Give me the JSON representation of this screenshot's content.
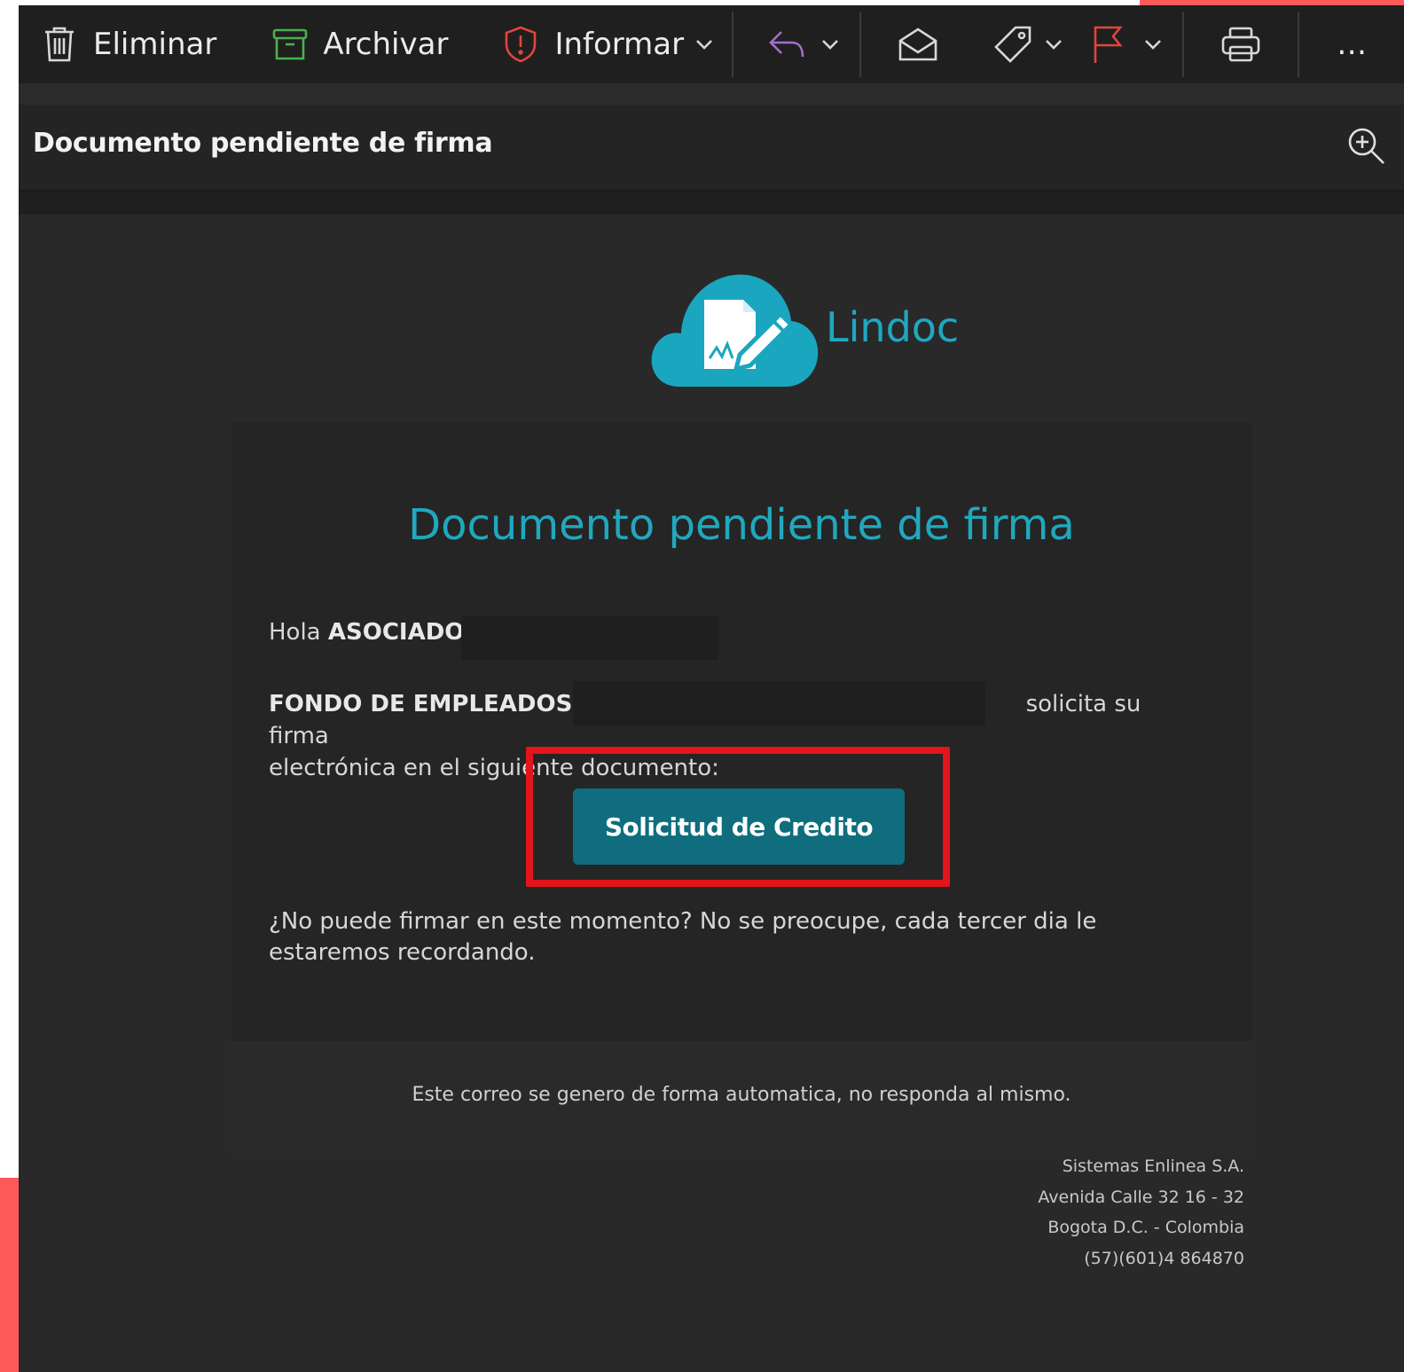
{
  "toolbar": {
    "delete_label": "Eliminar",
    "archive_label": "Archivar",
    "report_label": "Informar",
    "icons": [
      "trash-icon",
      "archive-icon",
      "shield-icon",
      "reply-icon",
      "open-envelope-icon",
      "tag-icon",
      "flag-icon",
      "print-icon",
      "more-icon"
    ],
    "more_label": "…"
  },
  "message": {
    "subject": "Documento pendiente de firma"
  },
  "email": {
    "brand": "Lindoc",
    "title": "Documento pendiente de firma",
    "greeting_prefix": "Hola",
    "greeting_name": "ASOCIADO",
    "sender_name": "FONDO DE EMPLEADOS I",
    "request_text_1": "solicita su firma",
    "request_text_2": "electrónica en el siguiente documento:",
    "button_label": "Solicitud de Credito",
    "note": "¿No puede firmar en este momento? No se preocupe, cada tercer dia le estaremos recordando.",
    "auto_message": "Este correo se genero de forma automatica, no responda al mismo."
  },
  "footer": {
    "company": "Sistemas Enlinea S.A.",
    "address": "Avenida Calle 32 16 - 32",
    "city": "Bogota D.C. - Colombia",
    "phone": "(57)(601)4 864870"
  },
  "colors": {
    "accent": "#20a8bd",
    "button": "#0f6d7e",
    "highlight": "#e3141c",
    "corner": "#ff5a5a"
  }
}
